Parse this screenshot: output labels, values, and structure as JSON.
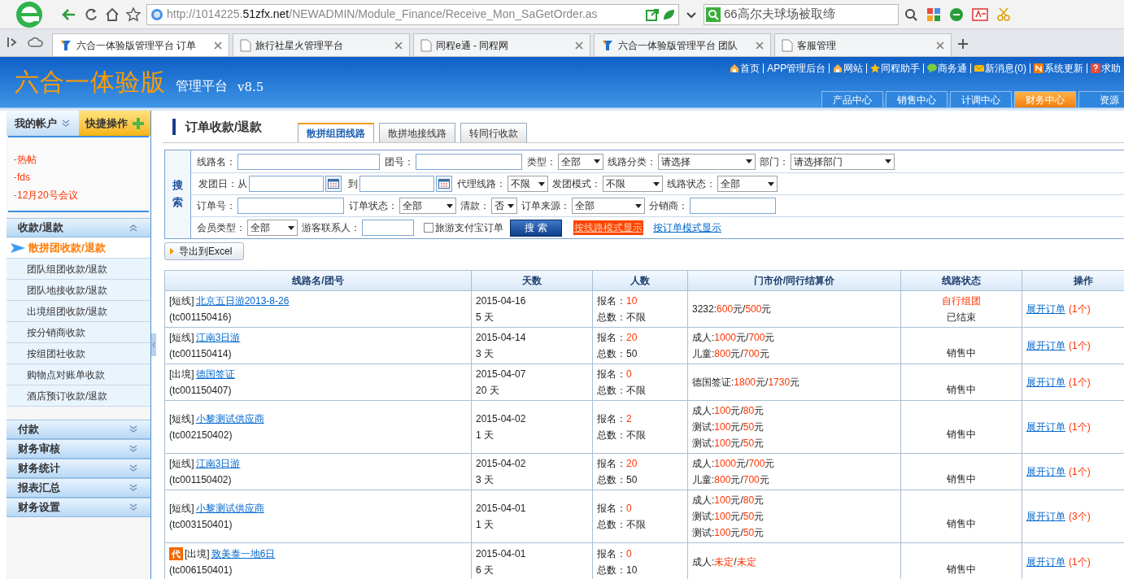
{
  "browser": {
    "url_prefix": "http://1014225.",
    "url_domain": "51zfx.net",
    "url_path": "/NEWADMIN/Module_Finance/Receive_Mon_SaGetOrder.as",
    "search": "66高尔夫球场被取缔",
    "tabs": [
      {
        "title": "六合一体验版管理平台 订单",
        "kind": "app",
        "selected": true
      },
      {
        "title": "旅行社星火管理平台",
        "kind": "page",
        "selected": false
      },
      {
        "title": "同程e通 - 同程网",
        "kind": "page",
        "selected": false
      },
      {
        "title": "六合一体验版管理平台 团队",
        "kind": "app",
        "selected": false
      },
      {
        "title": "客服管理",
        "kind": "page",
        "selected": false
      }
    ]
  },
  "header": {
    "logo": "六合一体验版",
    "subtitle": "管理平台",
    "version": "v8.5",
    "links": [
      {
        "text": "首页",
        "kind": "home"
      },
      {
        "text": "APP管理后台",
        "kind": "none"
      },
      {
        "text": "网站",
        "kind": "home"
      },
      {
        "text": "同程助手",
        "kind": "star"
      },
      {
        "text": "商务通",
        "kind": "chat"
      },
      {
        "text": "新消息(0)",
        "kind": "mail"
      },
      {
        "text": "系统更新",
        "kind": "news"
      },
      {
        "text": "求助",
        "kind": "help"
      }
    ],
    "nav": [
      {
        "label": "产品中心",
        "selected": false
      },
      {
        "label": "销售中心",
        "selected": false
      },
      {
        "label": "计调中心",
        "selected": false
      },
      {
        "label": "财务中心",
        "selected": true
      },
      {
        "label": "资源",
        "selected": false
      }
    ]
  },
  "sidebar": {
    "tabs": [
      {
        "label": "我的帐户",
        "selected": false
      },
      {
        "label": "快捷操作",
        "selected": true
      }
    ],
    "notices": [
      "热帖",
      "fds",
      "12月20号会议"
    ],
    "menu": [
      {
        "label": "收款/退款",
        "expanded": true,
        "children": [
          {
            "label": "散拼团收款/退款",
            "selected": true
          },
          {
            "label": "团队组团收款/退款",
            "selected": false
          },
          {
            "label": "团队地接收款/退款",
            "selected": false
          },
          {
            "label": "出境组团收款/退款",
            "selected": false
          },
          {
            "label": "按分销商收款",
            "selected": false
          },
          {
            "label": "按组团社收款",
            "selected": false
          },
          {
            "label": "购物点对账单收款",
            "selected": false
          },
          {
            "label": "酒店预订收款/退款",
            "selected": false
          }
        ]
      },
      {
        "label": "付款",
        "expanded": false
      },
      {
        "label": "财务审核",
        "expanded": false
      },
      {
        "label": "财务统计",
        "expanded": false
      },
      {
        "label": "报表汇总",
        "expanded": false
      },
      {
        "label": "财务设置",
        "expanded": false
      }
    ]
  },
  "main": {
    "title": "订单收款/退款",
    "tabs": [
      {
        "label": "散拼组团线路",
        "selected": true
      },
      {
        "label": "散拼地接线路",
        "selected": false
      },
      {
        "label": "转同行收款",
        "selected": false
      }
    ],
    "search": {
      "label": "搜索",
      "rows": [
        {
          "fields": [
            {
              "kind": "input",
              "label": "线路名："
            },
            {
              "kind": "input",
              "label": "团号："
            },
            {
              "kind": "select",
              "label": "类型：",
              "value": "全部"
            },
            {
              "kind": "select",
              "label": "线路分类：",
              "value": "请选择"
            },
            {
              "kind": "select",
              "label": "部门：",
              "value": "请选择部门"
            }
          ]
        },
        {
          "fields": [
            {
              "kind": "date",
              "label": "发团日：从"
            },
            {
              "kind": "date",
              "label": "到"
            },
            {
              "kind": "select",
              "label": "代理线路：",
              "value": "不限"
            },
            {
              "kind": "select",
              "label": "发团模式：",
              "value": "不限"
            },
            {
              "kind": "select",
              "label": "线路状态：",
              "value": "全部"
            }
          ]
        },
        {
          "fields": [
            {
              "kind": "input",
              "label": "订单号："
            },
            {
              "kind": "select",
              "label": "订单状态：",
              "value": "全部"
            },
            {
              "kind": "select",
              "label": "清款：",
              "value": "否"
            },
            {
              "kind": "select",
              "label": "订单来源：",
              "value": "全部"
            },
            {
              "kind": "input",
              "label": "分销商："
            }
          ]
        },
        {
          "fields": [
            {
              "kind": "select",
              "label": "会员类型：",
              "value": "全部"
            },
            {
              "kind": "input",
              "label": "游客联系人："
            },
            {
              "kind": "checkbox",
              "label": "旅游支付宝订单",
              "checked": false
            },
            {
              "kind": "button",
              "label": "搜 索"
            },
            {
              "kind": "link",
              "label": "按线路模式显示",
              "selected": true
            },
            {
              "kind": "link",
              "label": "按订单模式显示",
              "selected": false
            }
          ]
        }
      ]
    },
    "export_button": "导出到Excel",
    "table": {
      "columns": [
        "线路名/团号",
        "天数",
        "人数",
        "门市价/同行结算价",
        "线路状态",
        "操作"
      ],
      "rows": [
        {
          "tag": "[短线]",
          "name": "北京五日游2013-8-26",
          "code": "(tc001150416)",
          "date": "2015-04-16",
          "days": "5 天",
          "signed_label": "报名：",
          "signed": "10",
          "total_label": "总数：",
          "total": "不限",
          "prices": [
            [
              {
                "text": "3232:",
                "highlight": false
              },
              {
                "text": "600",
                "highlight": true
              },
              {
                "text": "元/",
                "highlight": false
              },
              {
                "text": "500",
                "highlight": true
              },
              {
                "text": "元",
                "highlight": false
              }
            ]
          ],
          "status": [
            {
              "text": "自行组团",
              "highlight": true
            },
            {
              "text": "已结束",
              "highlight": false
            }
          ],
          "action": "展开订单",
          "count": "(1个)"
        },
        {
          "tag": "[短线]",
          "name": "江南3日游",
          "code": "(tc001150414)",
          "date": "2015-04-14",
          "days": "3 天",
          "signed_label": "报名：",
          "signed": "20",
          "total_label": "总数：",
          "total": "50",
          "prices": [
            [
              {
                "text": "成人:",
                "highlight": false
              },
              {
                "text": "1000",
                "highlight": true
              },
              {
                "text": "元/",
                "highlight": false
              },
              {
                "text": "700",
                "highlight": true
              },
              {
                "text": "元",
                "highlight": false
              }
            ],
            [
              {
                "text": "儿童:",
                "highlight": false
              },
              {
                "text": "800",
                "highlight": true
              },
              {
                "text": "元/",
                "highlight": false
              },
              {
                "text": "700",
                "highlight": true
              },
              {
                "text": "元",
                "highlight": false
              }
            ]
          ],
          "status": [
            {
              "text": "销售中",
              "highlight": false
            }
          ],
          "action": "展开订单",
          "count": "(1个)"
        },
        {
          "tag": "[出境]",
          "name": "德国签证",
          "code": "(tc001150407)",
          "date": "2015-04-07",
          "days": "20 天",
          "signed_label": "报名：",
          "signed": "0",
          "total_label": "总数：",
          "total": "不限",
          "prices": [
            [
              {
                "text": "德国签证:",
                "highlight": false
              },
              {
                "text": "1800",
                "highlight": true
              },
              {
                "text": "元/",
                "highlight": false
              },
              {
                "text": "1730",
                "highlight": true
              },
              {
                "text": "元",
                "highlight": false
              }
            ]
          ],
          "status": [
            {
              "text": "销售中",
              "highlight": false
            }
          ],
          "action": "展开订单",
          "count": "(1个)"
        },
        {
          "tag": "[短线]",
          "name": "小黎测试供应商",
          "code": "(tc002150402)",
          "date": "2015-04-02",
          "days": "1 天",
          "signed_label": "报名：",
          "signed": "2",
          "total_label": "总数：",
          "total": "不限",
          "prices": [
            [
              {
                "text": "成人:",
                "highlight": false
              },
              {
                "text": "100",
                "highlight": true
              },
              {
                "text": "元/",
                "highlight": false
              },
              {
                "text": "80",
                "highlight": true
              },
              {
                "text": "元",
                "highlight": false
              }
            ],
            [
              {
                "text": "测试:",
                "highlight": false
              },
              {
                "text": "100",
                "highlight": true
              },
              {
                "text": "元/",
                "highlight": false
              },
              {
                "text": "50",
                "highlight": true
              },
              {
                "text": "元",
                "highlight": false
              }
            ],
            [
              {
                "text": "测试:",
                "highlight": false
              },
              {
                "text": "100",
                "highlight": true
              },
              {
                "text": "元/",
                "highlight": false
              },
              {
                "text": "50",
                "highlight": true
              },
              {
                "text": "元",
                "highlight": false
              }
            ]
          ],
          "status": [
            {
              "text": "销售中",
              "highlight": false
            }
          ],
          "action": "展开订单",
          "count": "(1个)"
        },
        {
          "tag": "[短线]",
          "name": "江南3日游",
          "code": "(tc001150402)",
          "date": "2015-04-02",
          "days": "3 天",
          "signed_label": "报名：",
          "signed": "20",
          "total_label": "总数：",
          "total": "50",
          "prices": [
            [
              {
                "text": "成人:",
                "highlight": false
              },
              {
                "text": "1000",
                "highlight": true
              },
              {
                "text": "元/",
                "highlight": false
              },
              {
                "text": "700",
                "highlight": true
              },
              {
                "text": "元",
                "highlight": false
              }
            ],
            [
              {
                "text": "儿童:",
                "highlight": false
              },
              {
                "text": "800",
                "highlight": true
              },
              {
                "text": "元/",
                "highlight": false
              },
              {
                "text": "700",
                "highlight": true
              },
              {
                "text": "元",
                "highlight": false
              }
            ]
          ],
          "status": [
            {
              "text": "销售中",
              "highlight": false
            }
          ],
          "action": "展开订单",
          "count": "(1个)"
        },
        {
          "tag": "[短线]",
          "name": "小黎测试供应商",
          "code": "(tc003150401)",
          "date": "2015-04-01",
          "days": "1 天",
          "signed_label": "报名：",
          "signed": "0",
          "total_label": "总数：",
          "total": "不限",
          "prices": [
            [
              {
                "text": "成人:",
                "highlight": false
              },
              {
                "text": "100",
                "highlight": true
              },
              {
                "text": "元/",
                "highlight": false
              },
              {
                "text": "80",
                "highlight": true
              },
              {
                "text": "元",
                "highlight": false
              }
            ],
            [
              {
                "text": "测试:",
                "highlight": false
              },
              {
                "text": "100",
                "highlight": true
              },
              {
                "text": "元/",
                "highlight": false
              },
              {
                "text": "50",
                "highlight": true
              },
              {
                "text": "元",
                "highlight": false
              }
            ],
            [
              {
                "text": "测试:",
                "highlight": false
              },
              {
                "text": "100",
                "highlight": true
              },
              {
                "text": "元/",
                "highlight": false
              },
              {
                "text": "50",
                "highlight": true
              },
              {
                "text": "元",
                "highlight": false
              }
            ]
          ],
          "status": [
            {
              "text": "销售中",
              "highlight": false
            }
          ],
          "action": "展开订单",
          "count": "(3个)"
        },
        {
          "badge": "代",
          "tag": "[出境]",
          "name": "致美泰一地6日",
          "code": "(tc006150401)",
          "date": "2015-04-01",
          "days": "6 天",
          "signed_label": "报名：",
          "signed": "0",
          "total_label": "总数：",
          "total": "10",
          "prices": [
            [
              {
                "text": "成人:",
                "highlight": false
              },
              {
                "text": "未定",
                "highlight": true
              },
              {
                "text": "/",
                "highlight": false
              },
              {
                "text": "未定",
                "highlight": true
              }
            ]
          ],
          "status": [
            {
              "text": "销售中",
              "highlight": false
            }
          ],
          "action": "展开订单",
          "count": "(1个)"
        }
      ]
    }
  }
}
